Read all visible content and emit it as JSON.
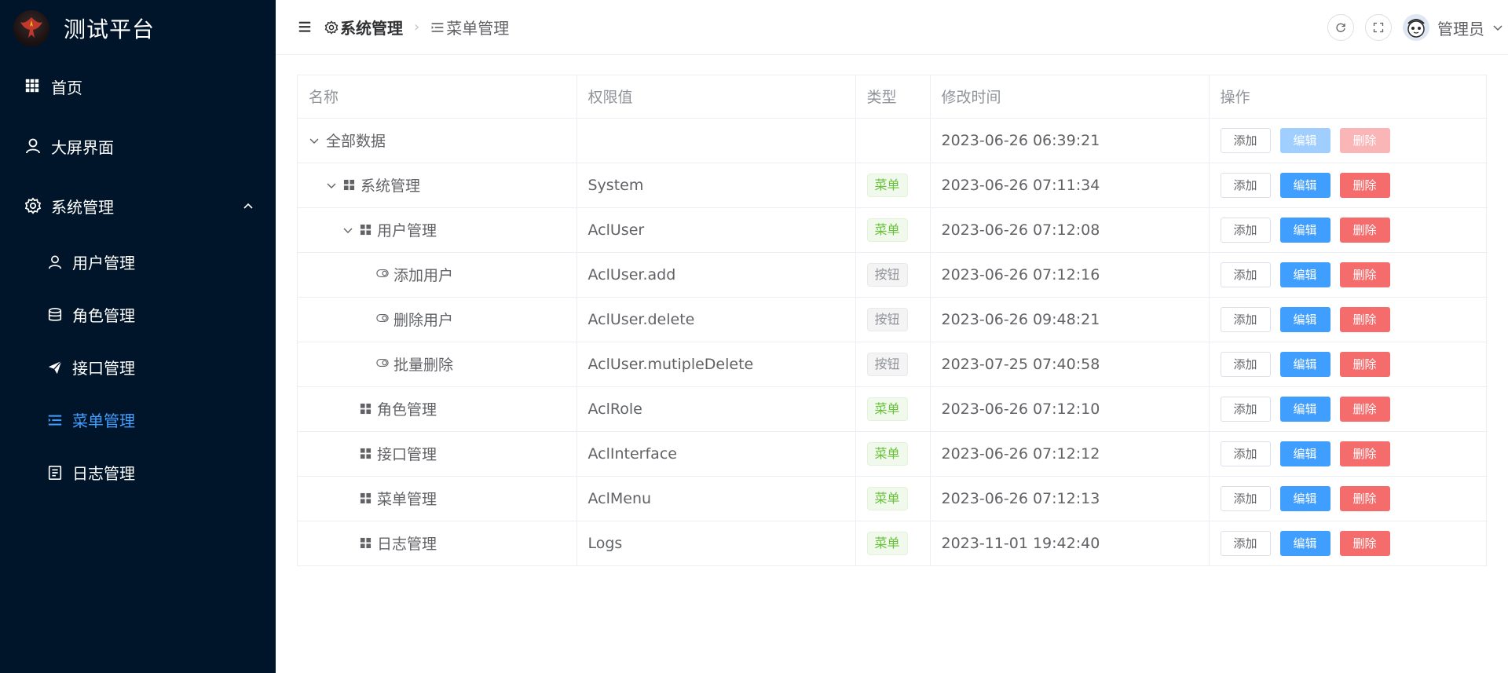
{
  "sidebar": {
    "brand": "测试平台",
    "items": [
      {
        "label": "首页",
        "icon": "grid-icon"
      },
      {
        "label": "大屏界面",
        "icon": "user-icon"
      },
      {
        "label": "系统管理",
        "icon": "gear-icon",
        "expanded": true
      },
      {
        "label": "用户管理",
        "icon": "user-icon"
      },
      {
        "label": "角色管理",
        "icon": "database-icon"
      },
      {
        "label": "接口管理",
        "icon": "send-icon"
      },
      {
        "label": "菜单管理",
        "icon": "menu-icon",
        "active": true
      },
      {
        "label": "日志管理",
        "icon": "document-icon"
      }
    ]
  },
  "header": {
    "breadcrumb": [
      "系统管理",
      "菜单管理"
    ],
    "user": "管理员"
  },
  "table": {
    "columns": [
      "名称",
      "权限值",
      "类型",
      "修改时间",
      "操作"
    ],
    "actions": {
      "add": "添加",
      "edit": "编辑",
      "delete": "删除"
    },
    "rows": [
      {
        "name": "全部数据",
        "perm": "",
        "type": "",
        "time": "2023-06-26 06:39:21",
        "disabled": true
      },
      {
        "name": "系统管理",
        "perm": "System",
        "type": "菜单",
        "time": "2023-06-26 07:11:34"
      },
      {
        "name": "用户管理",
        "perm": "AclUser",
        "type": "菜单",
        "time": "2023-06-26 07:12:08"
      },
      {
        "name": "添加用户",
        "perm": "AclUser.add",
        "type": "按钮",
        "time": "2023-06-26 07:12:16"
      },
      {
        "name": "删除用户",
        "perm": "AclUser.delete",
        "type": "按钮",
        "time": "2023-06-26 09:48:21"
      },
      {
        "name": "批量删除",
        "perm": "AclUser.mutipleDelete",
        "type": "按钮",
        "time": "2023-07-25 07:40:58"
      },
      {
        "name": "角色管理",
        "perm": "AclRole",
        "type": "菜单",
        "time": "2023-06-26 07:12:10"
      },
      {
        "name": "接口管理",
        "perm": "AclInterface",
        "type": "菜单",
        "time": "2023-06-26 07:12:12"
      },
      {
        "name": "菜单管理",
        "perm": "AclMenu",
        "type": "菜单",
        "time": "2023-06-26 07:12:13"
      },
      {
        "name": "日志管理",
        "perm": "Logs",
        "type": "菜单",
        "time": "2023-11-01 19:42:40"
      }
    ]
  },
  "colors": {
    "sidebar_bg": "#001529",
    "active": "#409eff",
    "edit": "#409eff",
    "delete": "#f56c6c",
    "menu_tag": "#67c23a"
  }
}
